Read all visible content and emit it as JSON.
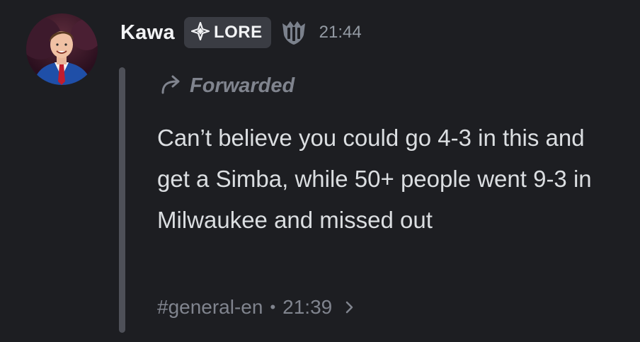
{
  "message": {
    "author": "Kawa",
    "tag": {
      "icon": "diamond-cross-icon",
      "label": "LORE"
    },
    "role_icon": "crown-shield-icon",
    "timestamp": "21:44",
    "forwarded_label": "Forwarded",
    "content": "Can’t believe you could go 4-3 in this and get a Simba, while 50+ people went 9-3 in Milwaukee and missed out",
    "source": {
      "channel": "#general-en",
      "separator": "•",
      "time": "21:39"
    }
  }
}
